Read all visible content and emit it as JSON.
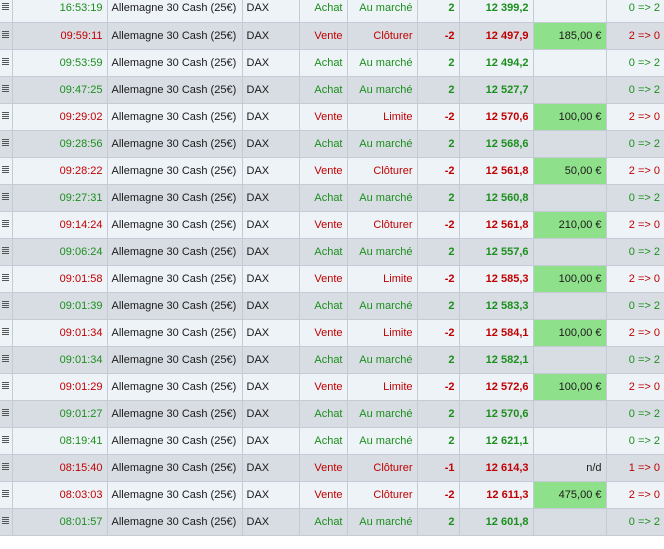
{
  "rows": [
    {
      "time": "16:53:19",
      "instrument": "Allemagne 30 Cash (25€)",
      "underlying": "DAX",
      "direction": "Achat",
      "order_type": "Au marché",
      "quantity": "2",
      "price": "12 399,2",
      "pnl": "",
      "position": "0 => 2",
      "side": "buy"
    },
    {
      "time": "09:59:11",
      "instrument": "Allemagne 30 Cash (25€)",
      "underlying": "DAX",
      "direction": "Vente",
      "order_type": "Clôturer",
      "quantity": "-2",
      "price": "12 497,9",
      "pnl": "185,00 €",
      "position": "2 => 0",
      "side": "sell"
    },
    {
      "time": "09:53:59",
      "instrument": "Allemagne 30 Cash (25€)",
      "underlying": "DAX",
      "direction": "Achat",
      "order_type": "Au marché",
      "quantity": "2",
      "price": "12 494,2",
      "pnl": "",
      "position": "0 => 2",
      "side": "buy"
    },
    {
      "time": "09:47:25",
      "instrument": "Allemagne 30 Cash (25€)",
      "underlying": "DAX",
      "direction": "Achat",
      "order_type": "Au marché",
      "quantity": "2",
      "price": "12 527,7",
      "pnl": "",
      "position": "0 => 2",
      "side": "buy"
    },
    {
      "time": "09:29:02",
      "instrument": "Allemagne 30 Cash (25€)",
      "underlying": "DAX",
      "direction": "Vente",
      "order_type": "Limite",
      "quantity": "-2",
      "price": "12 570,6",
      "pnl": "100,00 €",
      "position": "2 => 0",
      "side": "sell"
    },
    {
      "time": "09:28:56",
      "instrument": "Allemagne 30 Cash (25€)",
      "underlying": "DAX",
      "direction": "Achat",
      "order_type": "Au marché",
      "quantity": "2",
      "price": "12 568,6",
      "pnl": "",
      "position": "0 => 2",
      "side": "buy"
    },
    {
      "time": "09:28:22",
      "instrument": "Allemagne 30 Cash (25€)",
      "underlying": "DAX",
      "direction": "Vente",
      "order_type": "Clôturer",
      "quantity": "-2",
      "price": "12 561,8",
      "pnl": "50,00 €",
      "position": "2 => 0",
      "side": "sell"
    },
    {
      "time": "09:27:31",
      "instrument": "Allemagne 30 Cash (25€)",
      "underlying": "DAX",
      "direction": "Achat",
      "order_type": "Au marché",
      "quantity": "2",
      "price": "12 560,8",
      "pnl": "",
      "position": "0 => 2",
      "side": "buy"
    },
    {
      "time": "09:14:24",
      "instrument": "Allemagne 30 Cash (25€)",
      "underlying": "DAX",
      "direction": "Vente",
      "order_type": "Clôturer",
      "quantity": "-2",
      "price": "12 561,8",
      "pnl": "210,00 €",
      "position": "2 => 0",
      "side": "sell"
    },
    {
      "time": "09:06:24",
      "instrument": "Allemagne 30 Cash (25€)",
      "underlying": "DAX",
      "direction": "Achat",
      "order_type": "Au marché",
      "quantity": "2",
      "price": "12 557,6",
      "pnl": "",
      "position": "0 => 2",
      "side": "buy"
    },
    {
      "time": "09:01:58",
      "instrument": "Allemagne 30 Cash (25€)",
      "underlying": "DAX",
      "direction": "Vente",
      "order_type": "Limite",
      "quantity": "-2",
      "price": "12 585,3",
      "pnl": "100,00 €",
      "position": "2 => 0",
      "side": "sell"
    },
    {
      "time": "09:01:39",
      "instrument": "Allemagne 30 Cash (25€)",
      "underlying": "DAX",
      "direction": "Achat",
      "order_type": "Au marché",
      "quantity": "2",
      "price": "12 583,3",
      "pnl": "",
      "position": "0 => 2",
      "side": "buy"
    },
    {
      "time": "09:01:34",
      "instrument": "Allemagne 30 Cash (25€)",
      "underlying": "DAX",
      "direction": "Vente",
      "order_type": "Limite",
      "quantity": "-2",
      "price": "12 584,1",
      "pnl": "100,00 €",
      "position": "2 => 0",
      "side": "sell"
    },
    {
      "time": "09:01:34",
      "instrument": "Allemagne 30 Cash (25€)",
      "underlying": "DAX",
      "direction": "Achat",
      "order_type": "Au marché",
      "quantity": "2",
      "price": "12 582,1",
      "pnl": "",
      "position": "0 => 2",
      "side": "buy"
    },
    {
      "time": "09:01:29",
      "instrument": "Allemagne 30 Cash (25€)",
      "underlying": "DAX",
      "direction": "Vente",
      "order_type": "Limite",
      "quantity": "-2",
      "price": "12 572,6",
      "pnl": "100,00 €",
      "position": "2 => 0",
      "side": "sell"
    },
    {
      "time": "09:01:27",
      "instrument": "Allemagne 30 Cash (25€)",
      "underlying": "DAX",
      "direction": "Achat",
      "order_type": "Au marché",
      "quantity": "2",
      "price": "12 570,6",
      "pnl": "",
      "position": "0 => 2",
      "side": "buy"
    },
    {
      "time": "08:19:41",
      "instrument": "Allemagne 30 Cash (25€)",
      "underlying": "DAX",
      "direction": "Achat",
      "order_type": "Au marché",
      "quantity": "2",
      "price": "12 621,1",
      "pnl": "",
      "position": "0 => 2",
      "side": "buy"
    },
    {
      "time": "08:15:40",
      "instrument": "Allemagne 30 Cash (25€)",
      "underlying": "DAX",
      "direction": "Vente",
      "order_type": "Clôturer",
      "quantity": "-1",
      "price": "12 614,3",
      "pnl": "n/d",
      "position": "1 => 0",
      "side": "sell"
    },
    {
      "time": "08:03:03",
      "instrument": "Allemagne 30 Cash (25€)",
      "underlying": "DAX",
      "direction": "Vente",
      "order_type": "Clôturer",
      "quantity": "-2",
      "price": "12 611,3",
      "pnl": "475,00 €",
      "position": "2 => 0",
      "side": "sell"
    },
    {
      "time": "08:01:57",
      "instrument": "Allemagne 30 Cash (25€)",
      "underlying": "DAX",
      "direction": "Achat",
      "order_type": "Au marché",
      "quantity": "2",
      "price": "12 601,8",
      "pnl": "",
      "position": "0 => 2",
      "side": "buy"
    }
  ],
  "icon": "document-list-icon",
  "colors": {
    "buy": "#1b8f1b",
    "sell": "#c00000",
    "pnl_positive_bg": "#8fe08a"
  }
}
